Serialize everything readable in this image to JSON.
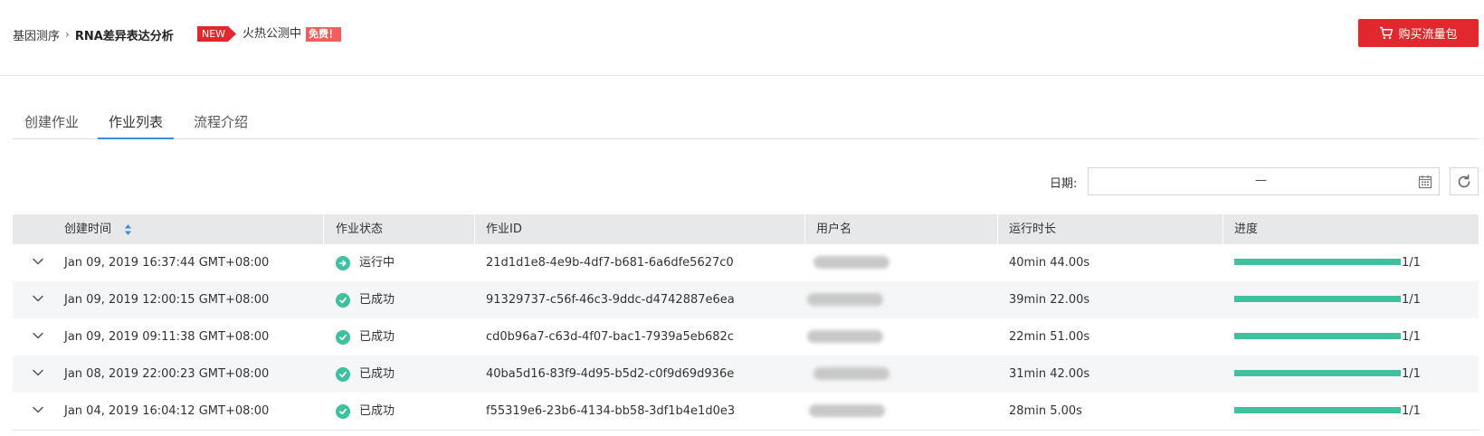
{
  "header": {
    "breadcrumb_root": "基因测序",
    "breadcrumb_sep": "›",
    "breadcrumb_current": "RNA差异表达分析",
    "new_badge": "NEW",
    "promo_text": "火热公测中",
    "free_badge": "免费！",
    "buy_button": "购买流量包"
  },
  "tabs": [
    {
      "label": "创建作业",
      "active": false
    },
    {
      "label": "作业列表",
      "active": true
    },
    {
      "label": "流程介绍",
      "active": false
    }
  ],
  "filter": {
    "date_label": "日期:",
    "date_separator": "—"
  },
  "table": {
    "headers": [
      "创建时间",
      "作业状态",
      "作业ID",
      "用户名",
      "运行时长",
      "进度"
    ],
    "rows": [
      {
        "created": "Jan 09, 2019 16:37:44 GMT+08:00",
        "status": "运行中",
        "status_type": "running",
        "job_id": "21d1d1e8-4e9b-4df7-b681-6a6dfe5627c0",
        "duration": "40min 44.00s",
        "progress": 1.0,
        "progress_text": "1/1"
      },
      {
        "created": "Jan 09, 2019 12:00:15 GMT+08:00",
        "status": "已成功",
        "status_type": "success",
        "job_id": "91329737-c56f-46c3-9ddc-d4742887e6ea",
        "duration": "39min 22.00s",
        "progress": 1.0,
        "progress_text": "1/1"
      },
      {
        "created": "Jan 09, 2019 09:11:38 GMT+08:00",
        "status": "已成功",
        "status_type": "success",
        "job_id": "cd0b96a7-c63d-4f07-bac1-7939a5eb682c",
        "duration": "22min 51.00s",
        "progress": 1.0,
        "progress_text": "1/1"
      },
      {
        "created": "Jan 08, 2019 22:00:23 GMT+08:00",
        "status": "已成功",
        "status_type": "success",
        "job_id": "40ba5d16-83f9-4d95-b5d2-c0f9d69d936e",
        "duration": "31min 42.00s",
        "progress": 1.0,
        "progress_text": "1/1"
      },
      {
        "created": "Jan 04, 2019 16:04:12 GMT+08:00",
        "status": "已成功",
        "status_type": "success",
        "job_id": "f55319e6-23b6-4134-bb58-3df1b4e1d0e3",
        "duration": "28min 5.00s",
        "progress": 1.0,
        "progress_text": "1/1"
      }
    ]
  },
  "colors": {
    "brand_red": "#e0282e",
    "tab_active": "#3c8ddb",
    "status_green": "#3fc1a0",
    "progress_fill": "#3fc1a0",
    "header_bg": "#e7e8ea"
  },
  "icons": {
    "buy": "shopping-cart-icon",
    "calendar": "calendar-icon",
    "refresh": "refresh-icon",
    "expand": "chevron-down-icon",
    "sort": "sort-icon",
    "running": "arrow-right-circle-icon",
    "success": "check-circle-icon"
  }
}
